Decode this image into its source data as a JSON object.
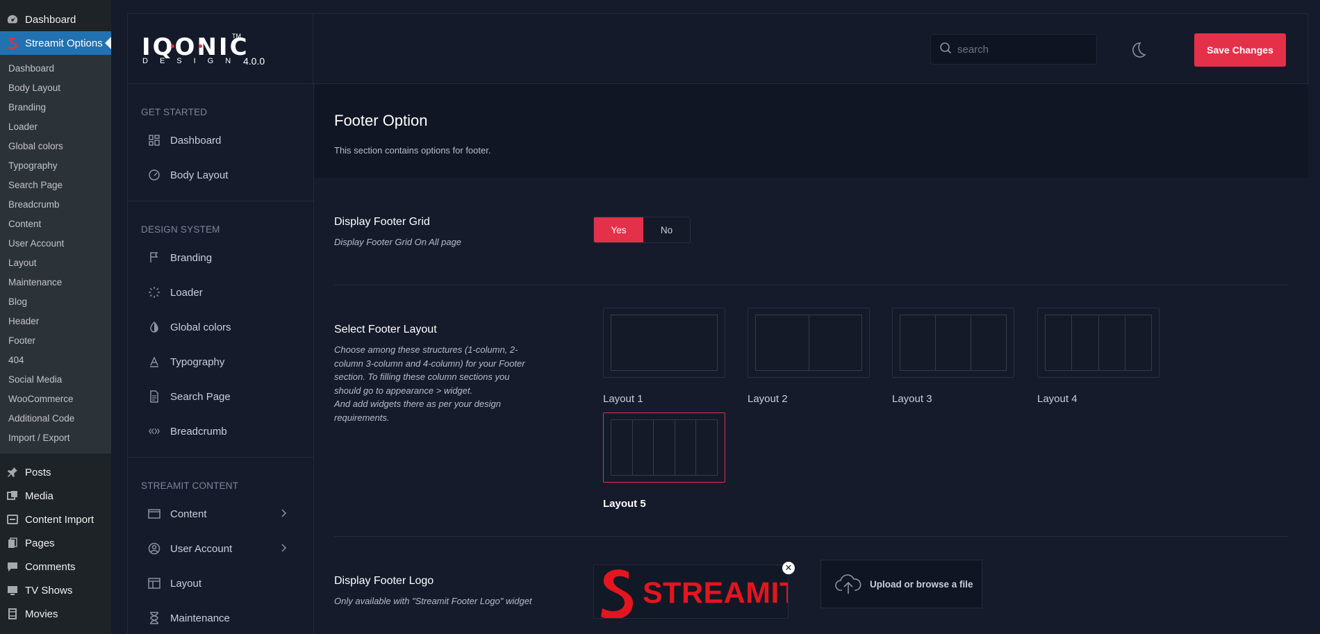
{
  "wp_sidebar": {
    "top_items": [
      {
        "label": "Dashboard",
        "icon": "gauge-icon"
      },
      {
        "label": "Streamit Options",
        "icon": "streamit-s-icon"
      }
    ],
    "submenu": [
      "Dashboard",
      "Body Layout",
      "Branding",
      "Loader",
      "Global colors",
      "Typography",
      "Search Page",
      "Breadcrumb",
      "Content",
      "User Account",
      "Layout",
      "Maintenance",
      "Blog",
      "Header",
      "Footer",
      "404",
      "Social Media",
      "WooCommerce",
      "Additional Code",
      "Import / Export"
    ],
    "bottom_items": [
      {
        "label": "Posts",
        "icon": "pin-icon"
      },
      {
        "label": "Media",
        "icon": "media-icon"
      },
      {
        "label": "Content Import",
        "icon": "import-icon"
      },
      {
        "label": "Pages",
        "icon": "pages-icon"
      },
      {
        "label": "Comments",
        "icon": "comment-icon"
      },
      {
        "label": "TV Shows",
        "icon": "tv-icon"
      },
      {
        "label": "Movies",
        "icon": "film-icon"
      }
    ]
  },
  "header": {
    "logo_word": "IQONIC",
    "logo_tm": "TM",
    "logo_sub": "DESIGN",
    "version": "4.0.0",
    "search_placeholder": "search",
    "save_label": "Save Changes"
  },
  "nav": {
    "sections": [
      {
        "heading": "GET STARTED",
        "items": [
          {
            "label": "Dashboard",
            "icon": "grid-icon"
          },
          {
            "label": "Body Layout",
            "icon": "speedometer-icon"
          }
        ]
      },
      {
        "heading": "DESIGN SYSTEM",
        "items": [
          {
            "label": "Branding",
            "icon": "flag-icon"
          },
          {
            "label": "Loader",
            "icon": "loader-icon"
          },
          {
            "label": "Global colors",
            "icon": "contrast-icon"
          },
          {
            "label": "Typography",
            "icon": "typography-icon"
          },
          {
            "label": "Search Page",
            "icon": "document-icon"
          },
          {
            "label": "Breadcrumb",
            "icon": "breadcrumb-icon"
          }
        ]
      },
      {
        "heading": "STREAMIT CONTENT",
        "items": [
          {
            "label": "Content",
            "icon": "window-icon",
            "chevron": true
          },
          {
            "label": "User Account",
            "icon": "user-circle-icon",
            "chevron": true
          },
          {
            "label": "Layout",
            "icon": "layout-icon"
          },
          {
            "label": "Maintenance",
            "icon": "hourglass-icon"
          }
        ]
      }
    ]
  },
  "page": {
    "title": "Footer Option",
    "description": "This section contains options for footer."
  },
  "footer_grid": {
    "title": "Display Footer Grid",
    "description": "Display Footer Grid On All page",
    "yes": "Yes",
    "no": "No",
    "selected": "Yes"
  },
  "footer_layout": {
    "title": "Select Footer Layout",
    "description_lines": [
      "Choose among these structures (1-column, 2-",
      "column 3-column and 4-column) for your Footer",
      "section. To filling these column sections you",
      "should go to appearance > widget.",
      "And add widgets there as per your design",
      "requirements."
    ],
    "layouts": [
      {
        "label": "Layout 1",
        "columns": 1
      },
      {
        "label": "Layout 2",
        "columns": 2
      },
      {
        "label": "Layout 3",
        "columns": 3
      },
      {
        "label": "Layout 4",
        "columns": 4
      },
      {
        "label": "Layout 5",
        "columns": 5
      }
    ],
    "selected": "Layout 5"
  },
  "footer_logo": {
    "title": "Display Footer Logo",
    "description": "Only available with \"Streamit Footer Logo\" widget",
    "logo_text": "STREAMIT",
    "upload_label": "Upload or browse a file"
  },
  "colors": {
    "accent": "#e5304a",
    "background": "#151b2b",
    "wp_sidebar": "#1d2327",
    "wp_active": "#2271b1"
  }
}
